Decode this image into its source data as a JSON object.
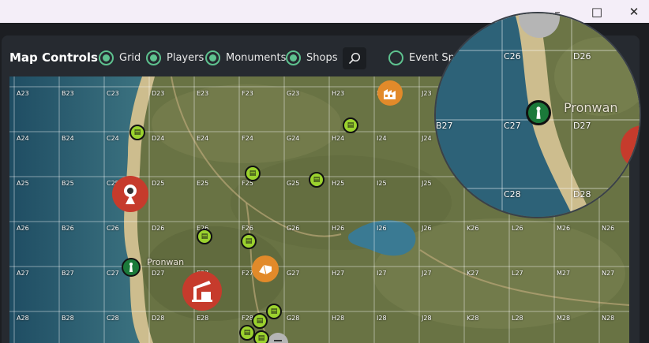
{
  "window": {
    "minimize_icon": "–",
    "maximize_icon": "□",
    "close_icon": "✕"
  },
  "controls": {
    "title": "Map Controls",
    "toggles": [
      {
        "label": "Grid",
        "checked": true
      },
      {
        "label": "Players",
        "checked": true
      },
      {
        "label": "Monuments",
        "checked": true
      },
      {
        "label": "Shops",
        "checked": true
      },
      {
        "label": "Event Spa",
        "checked": false
      }
    ],
    "search_icon": "search-icon"
  },
  "map": {
    "town_name": "Pronwan",
    "grid": [
      [
        "A23",
        "B23",
        "C23",
        "D23",
        "E23",
        "F23",
        "G23",
        "H23",
        "I23",
        "J23"
      ],
      [
        "A24",
        "B24",
        "C24",
        "D24",
        "E24",
        "F24",
        "G24",
        "H24",
        "I24",
        "J24"
      ],
      [
        "A25",
        "B25",
        "C25",
        "D25",
        "E25",
        "F25",
        "G25",
        "H25",
        "I25",
        "J25"
      ],
      [
        "A26",
        "B26",
        "C26",
        "D26",
        "E26",
        "F26",
        "G26",
        "H26",
        "I26",
        "J26",
        "K26",
        "L26",
        "M26",
        "N26"
      ],
      [
        "A27",
        "B27",
        "C27",
        "D27",
        "E27",
        "F27",
        "G27",
        "H27",
        "I27",
        "J27",
        "K27",
        "L27",
        "M27",
        "N27"
      ],
      [
        "A28",
        "B28",
        "C28",
        "D28",
        "E28",
        "F28",
        "G28",
        "H28",
        "I28",
        "J28",
        "K28",
        "L28",
        "M28",
        "N28"
      ]
    ],
    "colors": {
      "shop": "#9bd22e",
      "monument_red": "#c63b2c",
      "monument_orange": "#e28a2a",
      "ocean": "#2e5b6e"
    }
  },
  "magnifier": {
    "labels": [
      "C26",
      "D26",
      "B27",
      "C27",
      "D27",
      "C28",
      "D28"
    ],
    "town_name": "Pronwan"
  }
}
